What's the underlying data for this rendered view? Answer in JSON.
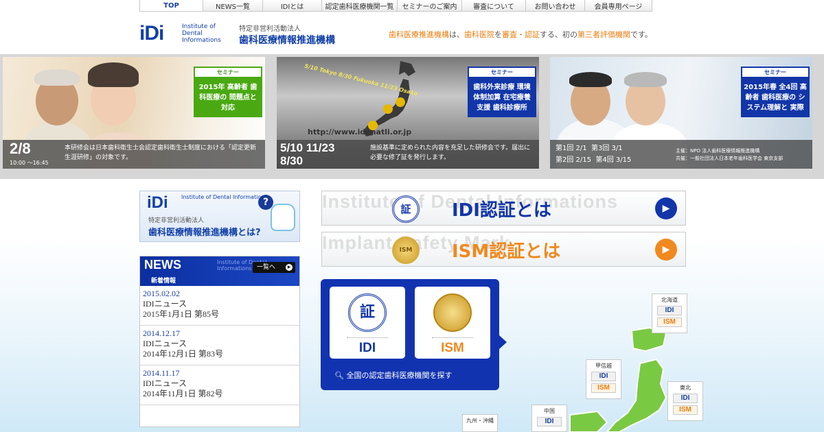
{
  "nav": {
    "tabs": [
      "TOP",
      "NEWS一覧",
      "IDIとは",
      "認定歯科医療機関一覧",
      "セミナーのご案内",
      "審査について",
      "お問い合わせ",
      "会員専用ページ"
    ]
  },
  "header": {
    "logo_mark": "iDi",
    "logo_en": "Institute of Dental Informations",
    "subtitle": "特定非営利活動法人",
    "org_name": "歯科医療情報推進機構",
    "tagline_1": "歯科医療推進機構",
    "tagline_2": "は、",
    "tagline_3": "歯科医院",
    "tagline_4": "を",
    "tagline_5": "審査・認証",
    "tagline_6": "する、初の",
    "tagline_7": "第三者評価機関",
    "tagline_8": "です。"
  },
  "banners": [
    {
      "tag": "セミナー",
      "card": "2015年 高齢者 歯科医療の 問題点と対応",
      "date": "2/8",
      "time": "10:00 〜16:45",
      "text": "本研修会は日本歯科衛生士会認定歯科衛生士制度における「認定更新生涯研修」の対象です。"
    },
    {
      "tag": "セミナー",
      "card": "歯科外来診療 環境体制加算 在宅療養支援 歯科診療所",
      "date_1": "5/10",
      "date_2": "11/23",
      "date_3": "8/30",
      "overlay": "5/10 Tokyo 8/30 Fukuoka 11/23 Osaka",
      "url": "http://www.idenatli.or.jp",
      "text": "施設基準に定められた内容を充足した研修会です。届出に必要な修了証を発行します。"
    },
    {
      "tag": "セミナー",
      "card": "2015年春 全4回 高齢者 歯科医療の システム理解と 実際",
      "session_1": "第1回 2/1",
      "session_2": "第3回 3/1",
      "session_3": "第2回 2/15",
      "session_4": "第4回 3/15",
      "org_1": "主催：NPO 法人歯科医療情報推進機構",
      "org_2": "共催：一般社団法人日本老年歯科医学会 東京支部"
    }
  ],
  "about": {
    "logo_mark": "iDi",
    "logo_en": "Institute of Dental Informations",
    "subtitle": "特定非営利活動法人",
    "title": "歯科医療情報推進機構とは?",
    "q": "?"
  },
  "news": {
    "title": "NEWS",
    "subtitle": "新着情報",
    "watermark": "Institute of Dental Informations",
    "more": "一覧へ",
    "items": [
      {
        "date": "2015.02.02",
        "cat": "IDIニュース",
        "line": "2015年1月1日 第85号"
      },
      {
        "date": "2014.12.17",
        "cat": "IDIニュース",
        "line": "2014年12月1日 第83号"
      },
      {
        "date": "2014.11.17",
        "cat": "IDIニュース",
        "line": "2014年11月1日 第82号"
      }
    ]
  },
  "certs": [
    {
      "watermark": "Institute of Dental Informations",
      "label": "IDI認証とは",
      "color": "#1236a8",
      "seal": "証"
    },
    {
      "watermark": "Implant Safety Mark",
      "label": "ISM認証とは",
      "color": "#f0891e",
      "seal": "ISM"
    }
  ],
  "search": {
    "idi_label": "IDI",
    "ism_label": "ISM",
    "seal_idi": "証",
    "footer": "全国の認定歯科医療機関を探す"
  },
  "regions": [
    {
      "name": "北海道",
      "badges": [
        "IDI",
        "ISM"
      ]
    },
    {
      "name": "甲信越",
      "badges": [
        "IDI",
        "ISM"
      ]
    },
    {
      "name": "東北",
      "badges": [
        "IDI",
        "ISM"
      ]
    },
    {
      "name": "中国",
      "badges": [
        "IDI"
      ]
    },
    {
      "name": "九州・沖縄",
      "badges": []
    }
  ]
}
